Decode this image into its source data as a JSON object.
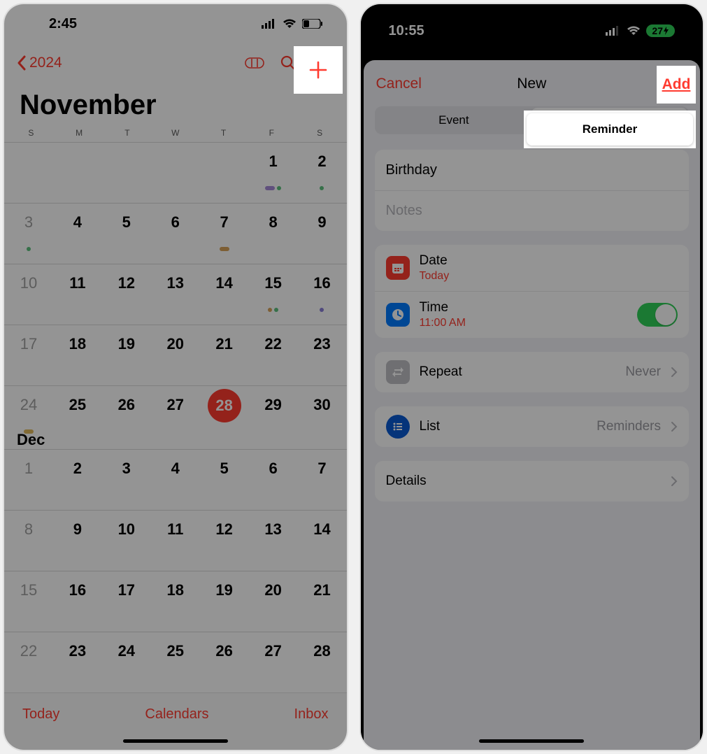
{
  "screen1": {
    "status_time": "2:45",
    "nav_year": "2024",
    "month_title": "November",
    "dow": [
      "S",
      "M",
      "T",
      "W",
      "T",
      "F",
      "S"
    ],
    "weeks": [
      [
        {
          "n": "",
          "f": true
        },
        {
          "n": "",
          "f": true
        },
        {
          "n": "",
          "f": true
        },
        {
          "n": "",
          "f": true
        },
        {
          "n": "",
          "f": true
        },
        {
          "n": "1",
          "dots": [
            {
              "t": "pill",
              "c": "#a68bd8"
            },
            {
              "t": "dot",
              "c": "#5ec27e"
            }
          ]
        },
        {
          "n": "2",
          "dots": [
            {
              "t": "dot",
              "c": "#5ec27e"
            }
          ]
        }
      ],
      [
        {
          "n": "3",
          "f": true,
          "dots": [
            {
              "t": "dot",
              "c": "#5ec27e"
            }
          ]
        },
        {
          "n": "4"
        },
        {
          "n": "5"
        },
        {
          "n": "6"
        },
        {
          "n": "7",
          "dots": [
            {
              "t": "pill",
              "c": "#d8a25b"
            }
          ]
        },
        {
          "n": "8"
        },
        {
          "n": "9"
        }
      ],
      [
        {
          "n": "10",
          "f": true
        },
        {
          "n": "11"
        },
        {
          "n": "12"
        },
        {
          "n": "13"
        },
        {
          "n": "14"
        },
        {
          "n": "15",
          "dots": [
            {
              "t": "dot",
              "c": "#d8a25b"
            },
            {
              "t": "dot",
              "c": "#5ec27e"
            }
          ]
        },
        {
          "n": "16",
          "dots": [
            {
              "t": "dot",
              "c": "#8a7ed8"
            }
          ]
        }
      ],
      [
        {
          "n": "17",
          "f": true
        },
        {
          "n": "18"
        },
        {
          "n": "19"
        },
        {
          "n": "20"
        },
        {
          "n": "21"
        },
        {
          "n": "22"
        },
        {
          "n": "23"
        }
      ],
      [
        {
          "n": "24",
          "f": true,
          "dots": [
            {
              "t": "pill",
              "c": "#e0b95c"
            }
          ]
        },
        {
          "n": "25"
        },
        {
          "n": "26"
        },
        {
          "n": "27"
        },
        {
          "n": "28",
          "sel": true
        },
        {
          "n": "29"
        },
        {
          "n": "30"
        }
      ]
    ],
    "next_month_label": "Dec",
    "dec_weeks": [
      [
        {
          "n": "1",
          "f": true
        },
        {
          "n": "2"
        },
        {
          "n": "3"
        },
        {
          "n": "4"
        },
        {
          "n": "5"
        },
        {
          "n": "6"
        },
        {
          "n": "7"
        }
      ],
      [
        {
          "n": "8",
          "f": true
        },
        {
          "n": "9"
        },
        {
          "n": "10"
        },
        {
          "n": "11"
        },
        {
          "n": "12"
        },
        {
          "n": "13"
        },
        {
          "n": "14"
        }
      ],
      [
        {
          "n": "15",
          "f": true
        },
        {
          "n": "16"
        },
        {
          "n": "17"
        },
        {
          "n": "18"
        },
        {
          "n": "19"
        },
        {
          "n": "20"
        },
        {
          "n": "21"
        }
      ],
      [
        {
          "n": "22",
          "f": true
        },
        {
          "n": "23"
        },
        {
          "n": "24"
        },
        {
          "n": "25"
        },
        {
          "n": "26"
        },
        {
          "n": "27"
        },
        {
          "n": "28"
        }
      ]
    ],
    "toolbar": {
      "today": "Today",
      "calendars": "Calendars",
      "inbox": "Inbox"
    }
  },
  "screen2": {
    "status_time": "10:55",
    "battery": "27",
    "sheet": {
      "cancel": "Cancel",
      "title": "New",
      "add": "Add",
      "segment": {
        "event": "Event",
        "reminder": "Reminder"
      },
      "title_field": "Birthday",
      "notes_placeholder": "Notes",
      "date": {
        "label": "Date",
        "value": "Today"
      },
      "time": {
        "label": "Time",
        "value": "11:00 AM"
      },
      "repeat": {
        "label": "Repeat",
        "value": "Never"
      },
      "list": {
        "label": "List",
        "value": "Reminders"
      },
      "details": "Details"
    }
  }
}
